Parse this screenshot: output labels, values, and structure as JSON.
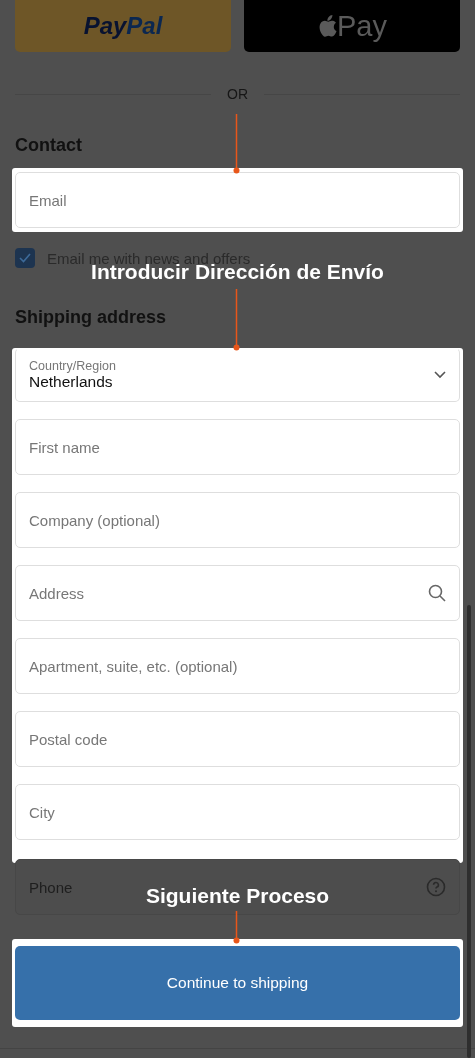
{
  "express_checkout": [
    {
      "kind": "paypal",
      "parts": [
        "Pay",
        "Pal"
      ]
    },
    {
      "kind": "apple_pay",
      "label": "Pay"
    }
  ],
  "divider": "OR",
  "contact": {
    "heading": "Contact",
    "email": {
      "placeholder": "Email"
    },
    "newsletter": {
      "label": "Email me with news and offers",
      "checked": true
    }
  },
  "shipping": {
    "heading": "Shipping address",
    "fields": [
      {
        "kind": "select",
        "label": "Country/Region",
        "value": "Netherlands"
      },
      {
        "kind": "text",
        "placeholder": "First name"
      },
      {
        "kind": "text",
        "placeholder": "Company (optional)"
      },
      {
        "kind": "search",
        "placeholder": "Address"
      },
      {
        "kind": "text",
        "placeholder": "Apartment, suite, etc. (optional)"
      },
      {
        "kind": "text",
        "placeholder": "Postal code"
      },
      {
        "kind": "text",
        "placeholder": "City"
      }
    ]
  },
  "phone": {
    "kind": "phone",
    "placeholder": "Phone"
  },
  "continue_button": "Continue to shipping",
  "annotations": [
    {
      "text": "Introducir Dirección de Envío"
    },
    {
      "text": "Siguiente Proceso"
    }
  ]
}
